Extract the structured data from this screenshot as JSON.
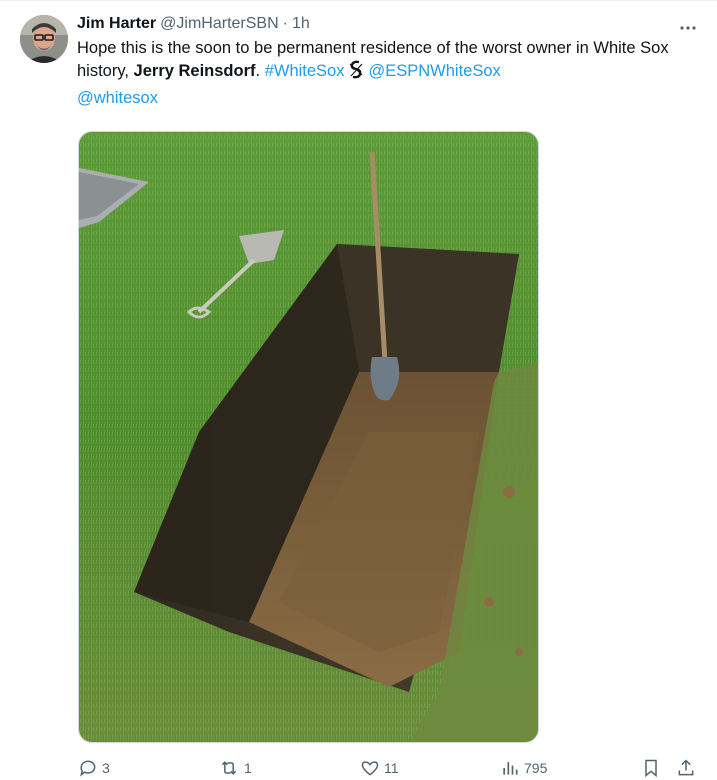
{
  "tweet": {
    "author_name": "Jim Harter",
    "author_handle": "@JimHarterSBN",
    "separator": "·",
    "time": "1h",
    "text_part1": "Hope this is the soon to be permanent residence of the worst owner in White Sox history, ",
    "text_bold": "Jerry Reinsdorf",
    "text_period": ". ",
    "hashtag": "#WhiteSox",
    "mention1": "@ESPNWhiteSox",
    "mention2": "@whitesox",
    "emoji": "white-sox-logo-icon",
    "media_description": "photo of freshly dug grave with shovel"
  },
  "actions": {
    "replies": "3",
    "reposts": "1",
    "likes": "11",
    "views": "795"
  },
  "colors": {
    "link": "#1d9bf0",
    "secondary_text": "#536471",
    "primary_text": "#0f1419",
    "border": "#cfd9de"
  }
}
